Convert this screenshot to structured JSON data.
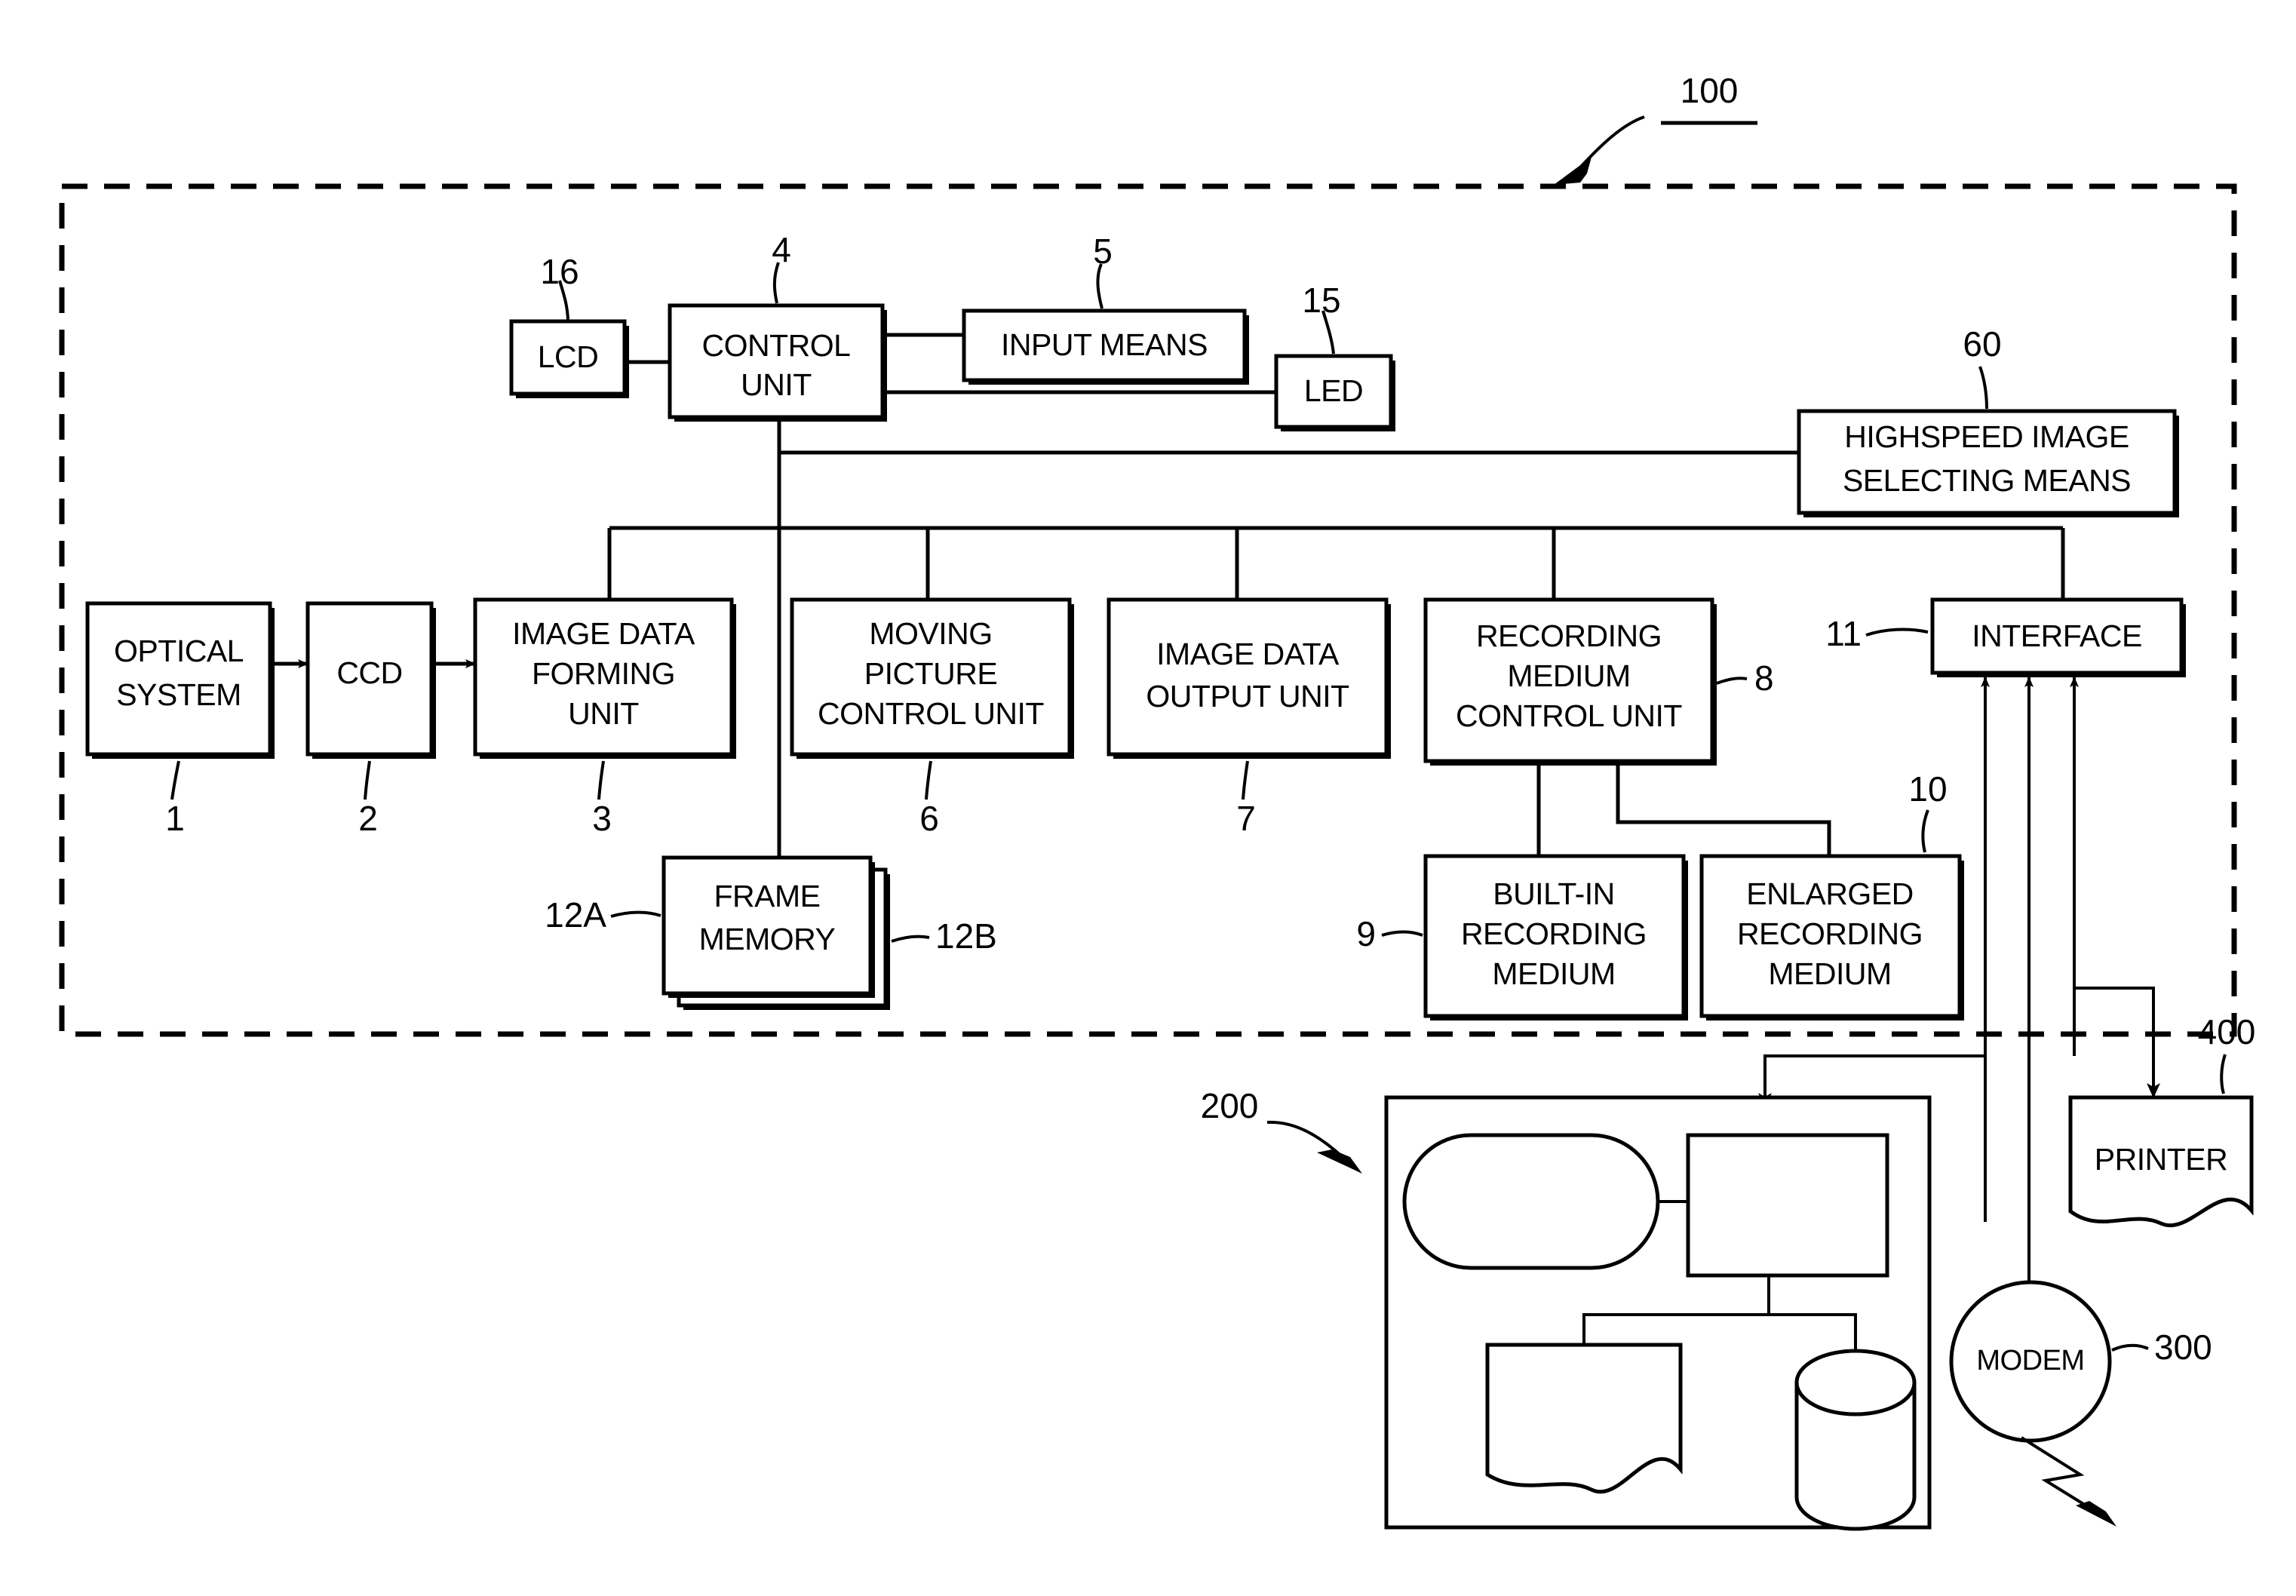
{
  "figure": {
    "system_ref": "100",
    "boxes": [
      {
        "id": "lcd",
        "label": "LCD",
        "ref": "16"
      },
      {
        "id": "control",
        "label": "CONTROL\nUNIT",
        "ref": "4"
      },
      {
        "id": "input",
        "label": "INPUT MEANS",
        "ref": "5"
      },
      {
        "id": "led",
        "label": "LED",
        "ref": "15"
      },
      {
        "id": "highspeed",
        "label": "HIGHSPEED IMAGE\nSELECTING MEANS",
        "ref": "60"
      },
      {
        "id": "optical",
        "label": "OPTICAL\nSYSTEM",
        "ref": "1"
      },
      {
        "id": "ccd",
        "label": "CCD",
        "ref": "2"
      },
      {
        "id": "imgform",
        "label": "IMAGE DATA\nFORMING\nUNIT",
        "ref": "3"
      },
      {
        "id": "moving",
        "label": "MOVING\nPICTURE\nCONTROL UNIT",
        "ref": "6"
      },
      {
        "id": "imgout",
        "label": "IMAGE DATA\nOUTPUT UNIT",
        "ref": "7"
      },
      {
        "id": "recmed",
        "label": "RECORDING\nMEDIUM\nCONTROL UNIT",
        "ref": "8"
      },
      {
        "id": "interface",
        "label": "INTERFACE",
        "ref": "11"
      },
      {
        "id": "framemem",
        "label": "FRAME\nMEMORY",
        "ref": "12A",
        "ref_b": "12B"
      },
      {
        "id": "builtin",
        "label": "BUILT-IN\nRECORDING\nMEDIUM",
        "ref": "9"
      },
      {
        "id": "enlarged",
        "label": "ENLARGED\nRECORDING\nMEDIUM",
        "ref": "10"
      },
      {
        "id": "printer",
        "label": "PRINTER",
        "ref": "400"
      },
      {
        "id": "modem",
        "label": "MODEM",
        "ref": "300"
      },
      {
        "id": "computer",
        "label": "",
        "ref": "200"
      }
    ],
    "labels": {
      "lcd": "LCD",
      "control_line1": "CONTROL",
      "control_line2": "UNIT",
      "input_means": "INPUT MEANS",
      "led": "LED",
      "highspeed_line1": "HIGHSPEED IMAGE",
      "highspeed_line2": "SELECTING MEANS",
      "optical_line1": "OPTICAL",
      "optical_line2": "SYSTEM",
      "ccd": "CCD",
      "imgform_line1": "IMAGE DATA",
      "imgform_line2": "FORMING",
      "imgform_line3": "UNIT",
      "moving_line1": "MOVING",
      "moving_line2": "PICTURE",
      "moving_line3": "CONTROL UNIT",
      "imgout_line1": "IMAGE DATA",
      "imgout_line2": "OUTPUT UNIT",
      "recmed_line1": "RECORDING",
      "recmed_line2": "MEDIUM",
      "recmed_line3": "CONTROL UNIT",
      "interface": "INTERFACE",
      "framemem_line1": "FRAME",
      "framemem_line2": "MEMORY",
      "builtin_line1": "BUILT-IN",
      "builtin_line2": "RECORDING",
      "builtin_line3": "MEDIUM",
      "enlarged_line1": "ENLARGED",
      "enlarged_line2": "RECORDING",
      "enlarged_line3": "MEDIUM",
      "printer": "PRINTER",
      "modem": "MODEM"
    },
    "refs": {
      "system": "100",
      "optical": "1",
      "ccd": "2",
      "imgform": "3",
      "control": "4",
      "input": "5",
      "moving": "6",
      "imgout": "7",
      "recmed": "8",
      "builtin": "9",
      "enlarged": "10",
      "interface": "11",
      "framemem_a": "12A",
      "framemem_b": "12B",
      "led": "15",
      "lcd": "16",
      "highspeed": "60",
      "computer": "200",
      "modem": "300",
      "printer": "400"
    }
  }
}
